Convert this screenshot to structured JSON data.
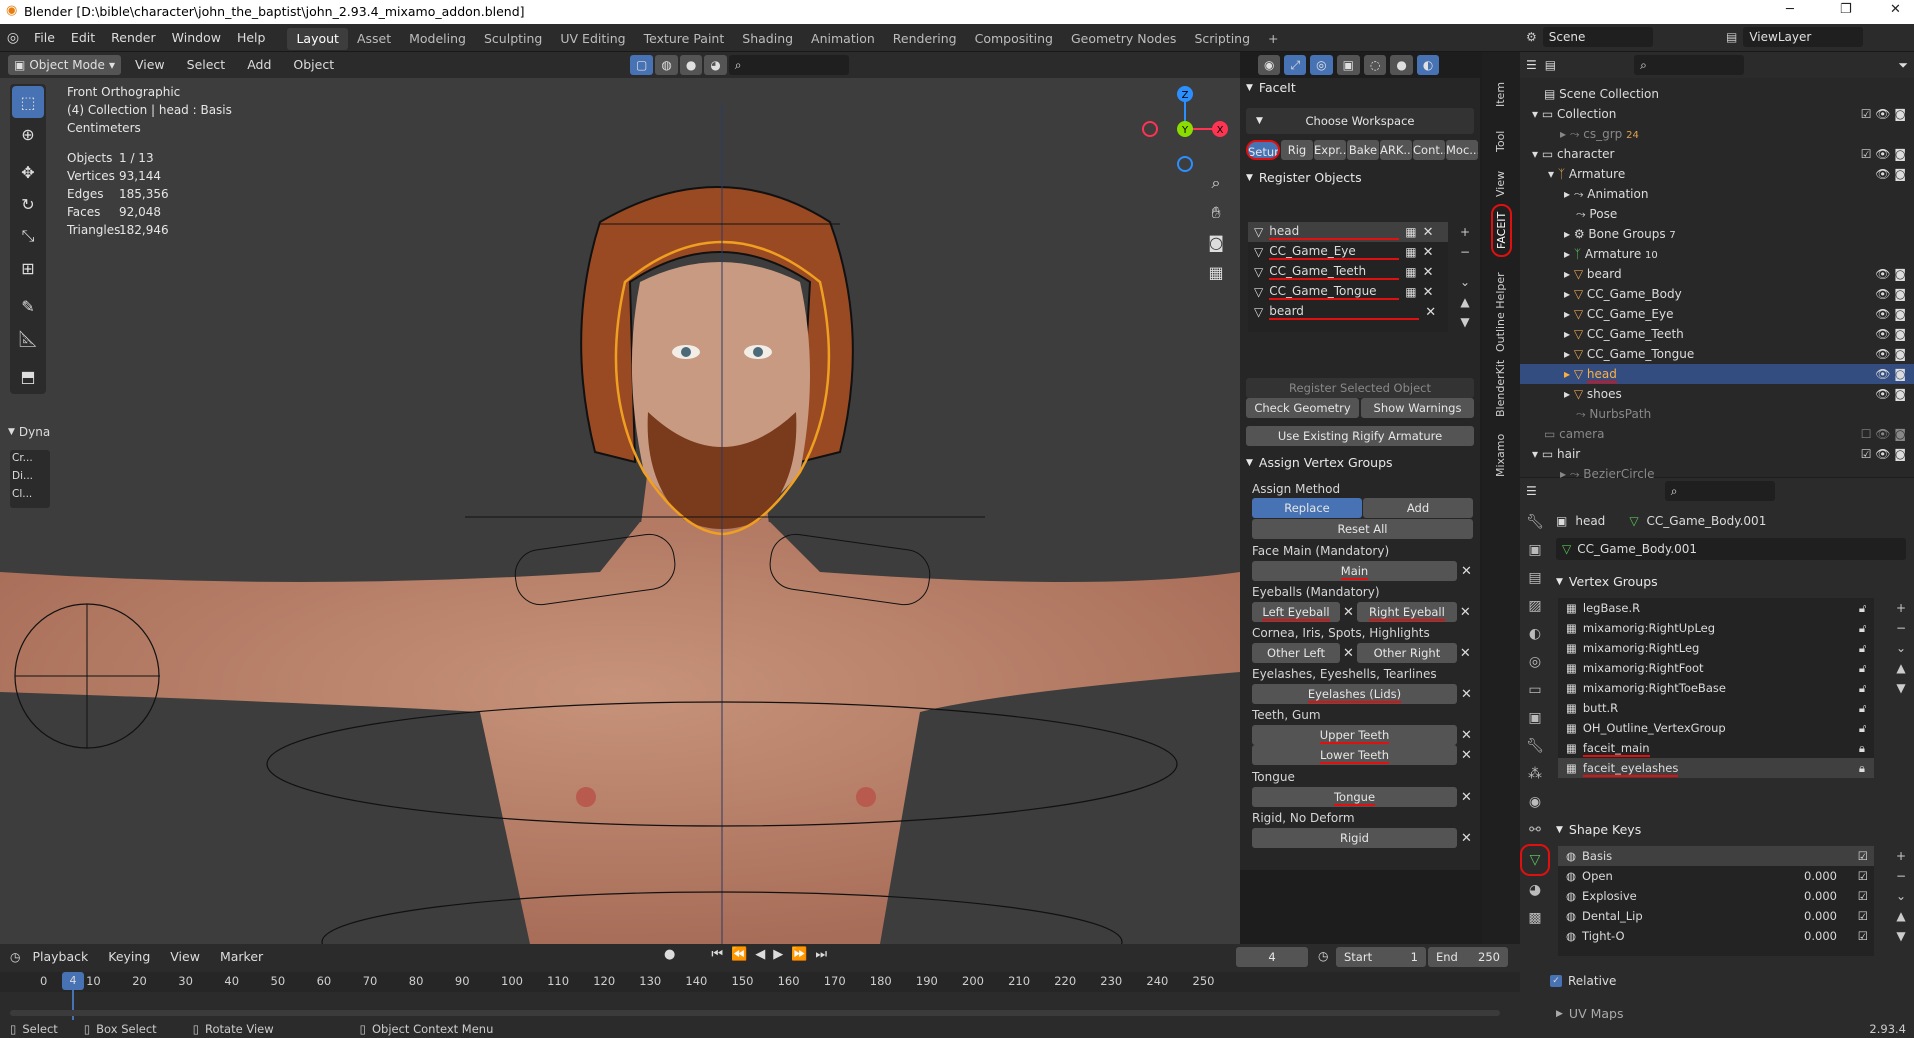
{
  "app": {
    "title": "Blender [D:\\bible\\character\\john_the_baptist\\john_2.93.4_mixamo_addon.blend]",
    "version": "2.93.4"
  },
  "menu": {
    "items": [
      "File",
      "Edit",
      "Render",
      "Window",
      "Help"
    ]
  },
  "workspaces": [
    "Layout",
    "Asset",
    "Modeling",
    "Sculpting",
    "UV Editing",
    "Texture Paint",
    "Shading",
    "Animation",
    "Rendering",
    "Compositing",
    "Geometry Nodes",
    "Scripting"
  ],
  "active_workspace": "Layout",
  "scene": {
    "name": "Scene",
    "viewlayer": "ViewLayer"
  },
  "viewport_header": {
    "mode": "Object Mode",
    "view": "View",
    "select": "Select",
    "add": "Add",
    "object": "Object"
  },
  "viewport_info": {
    "view_name": "Front Orthographic",
    "collection": "(4) Collection | head : Basis",
    "units": "Centimeters",
    "stats": [
      {
        "label": "Objects",
        "value": "1 / 13"
      },
      {
        "label": "Vertices",
        "value": "93,144"
      },
      {
        "label": "Edges",
        "value": "185,356"
      },
      {
        "label": "Faces",
        "value": "92,048"
      },
      {
        "label": "Triangles",
        "value": "182,946"
      }
    ]
  },
  "side_panel": {
    "dyna_label": "Dyna",
    "btn1": "Cr...",
    "btn2": "Di...",
    "btn3": "Cl..."
  },
  "gizmo": {
    "x": "X",
    "y": "Y",
    "z": "Z"
  },
  "faceit": {
    "title": "FaceIt",
    "choose_workspace": "Choose Workspace",
    "tabs": [
      "Setup",
      "Rig",
      "Expr...",
      "Bake",
      "ARK...",
      "Cont...",
      "Moc..."
    ],
    "register_title": "Register Objects",
    "objects": [
      "head",
      "CC_Game_Eye",
      "CC_Game_Teeth",
      "CC_Game_Tongue",
      "beard"
    ],
    "register_selected": "Register Selected Object",
    "check_geometry": "Check Geometry",
    "show_warnings": "Show Warnings",
    "use_rigify": "Use Existing Rigify Armature",
    "assign_title": "Assign Vertex Groups",
    "assign_method": "Assign Method",
    "replace": "Replace",
    "add": "Add",
    "reset_all": "Reset All",
    "face_main_label": "Face Main (Mandatory)",
    "main": "Main",
    "eyeballs_label": "Eyeballs (Mandatory)",
    "left_eyeball": "Left Eyeball",
    "right_eyeball": "Right Eyeball",
    "cornea_label": "Cornea, Iris, Spots, Highlights",
    "other_left": "Other Left",
    "other_right": "Other Right",
    "eyelashes_label": "Eyelashes, Eyeshells, Tearlines",
    "eyelashes": "Eyelashes (Lids)",
    "teeth_label": "Teeth, Gum",
    "upper_teeth": "Upper Teeth",
    "lower_teeth": "Lower Teeth",
    "tongue_label": "Tongue",
    "tongue": "Tongue",
    "rigid_label": "Rigid, No Deform",
    "rigid": "Rigid"
  },
  "vtabs": [
    "Item",
    "Tool",
    "View",
    "FACEIT",
    "Outline Helper",
    "BlenderKit",
    "Mixamo"
  ],
  "outliner": {
    "root": "Scene Collection",
    "items": [
      {
        "label": "Collection",
        "depth": 1
      },
      {
        "label": "cs_grp",
        "depth": 2,
        "badge": "24"
      },
      {
        "label": "character",
        "depth": 1
      },
      {
        "label": "Armature",
        "depth": 2
      },
      {
        "label": "Animation",
        "depth": 3
      },
      {
        "label": "Pose",
        "depth": 3
      },
      {
        "label": "Bone Groups",
        "depth": 3,
        "badge": "7"
      },
      {
        "label": "Armature",
        "depth": 3,
        "badge": "10"
      },
      {
        "label": "beard",
        "depth": 3
      },
      {
        "label": "CC_Game_Body",
        "depth": 3
      },
      {
        "label": "CC_Game_Eye",
        "depth": 3
      },
      {
        "label": "CC_Game_Teeth",
        "depth": 3
      },
      {
        "label": "CC_Game_Tongue",
        "depth": 3
      },
      {
        "label": "head",
        "depth": 3
      },
      {
        "label": "shoes",
        "depth": 3
      },
      {
        "label": "NurbsPath",
        "depth": 3
      },
      {
        "label": "camera",
        "depth": 1
      },
      {
        "label": "hair",
        "depth": 1
      },
      {
        "label": "BezierCircle",
        "depth": 2
      }
    ]
  },
  "properties": {
    "object": "head",
    "data": "CC_Game_Body.001",
    "mesh": "CC_Game_Body.001",
    "vg_title": "Vertex Groups",
    "vgroups": [
      "legBase.R",
      "mixamorig:RightUpLeg",
      "mixamorig:RightLeg",
      "mixamorig:RightFoot",
      "mixamorig:RightToeBase",
      "butt.R",
      "OH_Outline_VertexGroup",
      "faceit_main",
      "faceit_eyelashes"
    ],
    "sk_title": "Shape Keys",
    "shapekeys": [
      {
        "name": "Basis",
        "value": ""
      },
      {
        "name": "Open",
        "value": "0.000"
      },
      {
        "name": "Explosive",
        "value": "0.000"
      },
      {
        "name": "Dental_Lip",
        "value": "0.000"
      },
      {
        "name": "Tight-O",
        "value": "0.000"
      }
    ],
    "relative": "Relative",
    "uv_maps": "UV Maps"
  },
  "timeline": {
    "playback": "Playback",
    "keying": "Keying",
    "view": "View",
    "marker": "Marker",
    "current": "4",
    "start_label": "Start",
    "start": "1",
    "end_label": "End",
    "end": "250",
    "ticks": [
      "0",
      "10",
      "20",
      "30",
      "40",
      "50",
      "60",
      "70",
      "80",
      "90",
      "100",
      "110",
      "120",
      "130",
      "140",
      "150",
      "160",
      "170",
      "180",
      "190",
      "200",
      "210",
      "220",
      "230",
      "240",
      "250"
    ]
  },
  "status": {
    "select": "Select",
    "box_select": "Box Select",
    "rotate": "Rotate View",
    "context": "Object Context Menu"
  }
}
